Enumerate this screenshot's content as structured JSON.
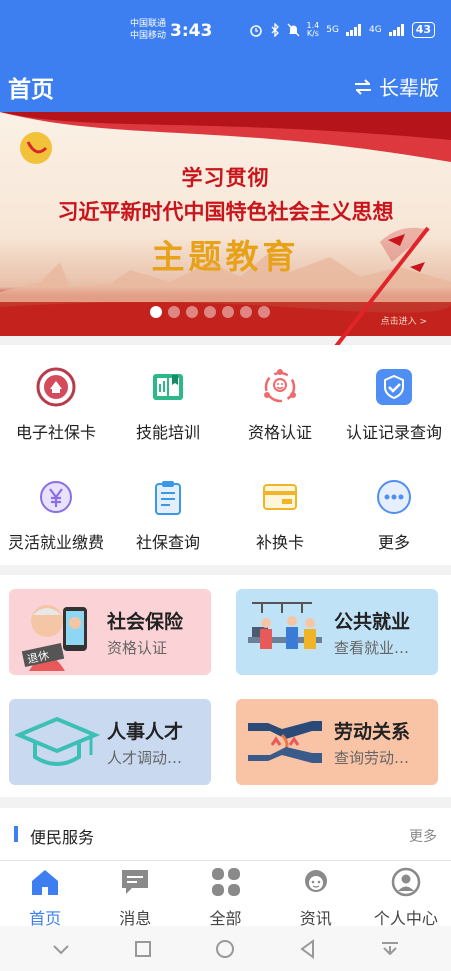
{
  "status": {
    "carrier_top": "中国联通",
    "carrier_bottom": "中国移动",
    "time": "3:43",
    "speed_value": "1.4",
    "speed_unit": "K/s",
    "signal_5g": "5G",
    "signal_4g": "4G",
    "battery": "43"
  },
  "header": {
    "title": "首页",
    "elder_mode": "长辈版"
  },
  "banner": {
    "line1": "学习贯彻",
    "line2": "习近平新时代中国特色社会主义思想",
    "line3": "主题教育",
    "enter": "点击进入 >",
    "dot_count": 7,
    "active_dot": 0
  },
  "grid": {
    "items": [
      {
        "label": "电子社保卡",
        "icon": "social-security-card-icon"
      },
      {
        "label": "技能培训",
        "icon": "book-icon"
      },
      {
        "label": "资格认证",
        "icon": "face-recognition-icon"
      },
      {
        "label": "认证记录查询",
        "icon": "shield-check-icon"
      },
      {
        "label": "灵活就业缴费",
        "icon": "yuan-coin-icon"
      },
      {
        "label": "社保查询",
        "icon": "clipboard-icon"
      },
      {
        "label": "补换卡",
        "icon": "card-icon"
      },
      {
        "label": "更多",
        "icon": "more-icon"
      }
    ]
  },
  "cards": [
    {
      "title": "社会保险",
      "subtitle": "资格认证",
      "bg": "#fbd3d6",
      "badge": "退休"
    },
    {
      "title": "公共就业",
      "subtitle": "查看就业…",
      "bg": "#bfe2f6"
    },
    {
      "title": "人事人才",
      "subtitle": "人才调动…",
      "bg": "#c9d9f0"
    },
    {
      "title": "劳动关系",
      "subtitle": "查询劳动…",
      "bg": "#f9c3a6"
    }
  ],
  "service": {
    "title": "便民服务",
    "more": "更多"
  },
  "tabs": [
    {
      "label": "首页",
      "icon": "home-icon",
      "active": true
    },
    {
      "label": "消息",
      "icon": "message-icon"
    },
    {
      "label": "全部",
      "icon": "grid-icon"
    },
    {
      "label": "资讯",
      "icon": "news-icon"
    },
    {
      "label": "个人中心",
      "icon": "user-icon"
    }
  ],
  "colors": {
    "primary": "#3d7ff0",
    "banner_red": "#c9141b",
    "banner_gold": "#e8a21a"
  }
}
